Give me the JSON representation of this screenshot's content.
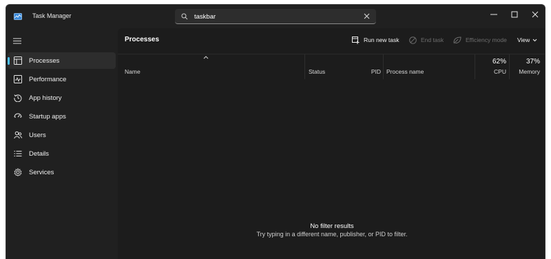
{
  "app": {
    "title": "Task Manager"
  },
  "search": {
    "value": "taskbar"
  },
  "sidebar": {
    "items": [
      {
        "label": "Processes",
        "icon": "processes-icon",
        "active": true
      },
      {
        "label": "Performance",
        "icon": "performance-icon",
        "active": false
      },
      {
        "label": "App history",
        "icon": "app-history-icon",
        "active": false
      },
      {
        "label": "Startup apps",
        "icon": "startup-apps-icon",
        "active": false
      },
      {
        "label": "Users",
        "icon": "users-icon",
        "active": false
      },
      {
        "label": "Details",
        "icon": "details-icon",
        "active": false
      },
      {
        "label": "Services",
        "icon": "services-icon",
        "active": false
      }
    ]
  },
  "main": {
    "title": "Processes",
    "toolbar": {
      "run_new_task": "Run new task",
      "end_task": "End task",
      "efficiency_mode": "Efficiency mode",
      "view": "View"
    },
    "columns": {
      "name": "Name",
      "status": "Status",
      "pid": "PID",
      "process_name": "Process name",
      "cpu_percent": "62%",
      "cpu": "CPU",
      "memory_percent": "37%",
      "memory": "Memory"
    },
    "empty": {
      "title": "No filter results",
      "subtitle": "Try typing in a different name, publisher, or PID to filter."
    }
  },
  "colors": {
    "accent": "#4cc2ff",
    "window_bg": "#202020",
    "panel_bg": "#1c1c1c",
    "disabled_text": "#6e6e6e"
  }
}
